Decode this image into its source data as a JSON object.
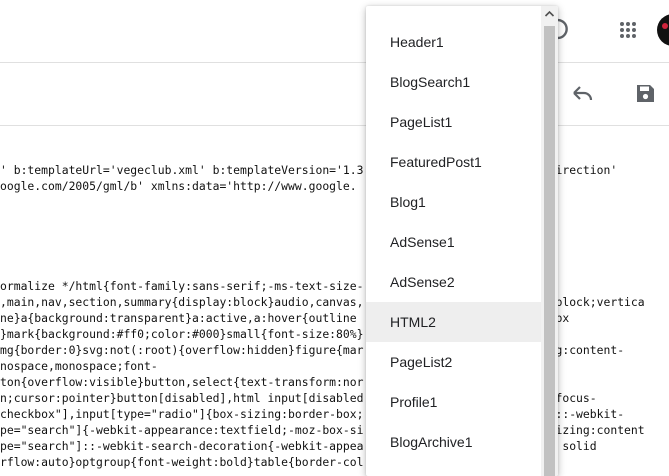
{
  "code_lines": [
    "' b:templateUrl='vegeclub.xml' b:templateVersion='1.3.                     guageDirection'",
    "oogle.com/2005/gml/b' xmlns:data='http://www.google.",
    "",
    "",
    "",
    "",
    "ormalize */html{font-family:sans-serif;-ms-text-size-                         ze-",
    ",main,nav,section,summary{display:block}audio,canvas,                         ne-block;vertica",
    "ne}a{background:transparent}a:active,a:hover{outline                          m:1px",
    "}mark{background:#ff0;color:#000}small{font-size:80%}",
    "mg{border:0}svg:not(:root){overflow:hidden}figure{mar                         zing:content-",
    "nospace,monospace;font-",
    "ton{overflow:visible}button,select{text-transform:nor",
    "n;cursor:pointer}button[disabled],html input[disabled                         oz-focus-",
    "checkbox\"],input[type=\"radio\"]{box-sizing:border-box;                         r\"]::-webkit-",
    "pe=\"search\"]{-webkit-appearance:textfield;-moz-box-si                         x-sizing:content",
    "pe=\"search\"]::-webkit-search-decoration{-webkit-appea                         1px solid",
    "rflow:auto}optgroup{font-weight:bold}table{border-col"
  ],
  "menu": {
    "items": [
      "Header1",
      "BlogSearch1",
      "PageList1",
      "FeaturedPost1",
      "Blog1",
      "AdSense1",
      "AdSense2",
      "HTML2",
      "PageList2",
      "Profile1",
      "BlogArchive1"
    ],
    "selected": "HTML2"
  },
  "icons": {
    "undo": "undo-icon",
    "save": "save-icon",
    "apps": "apps-grid-icon",
    "help": "help-icon",
    "avatar": "avatar"
  }
}
